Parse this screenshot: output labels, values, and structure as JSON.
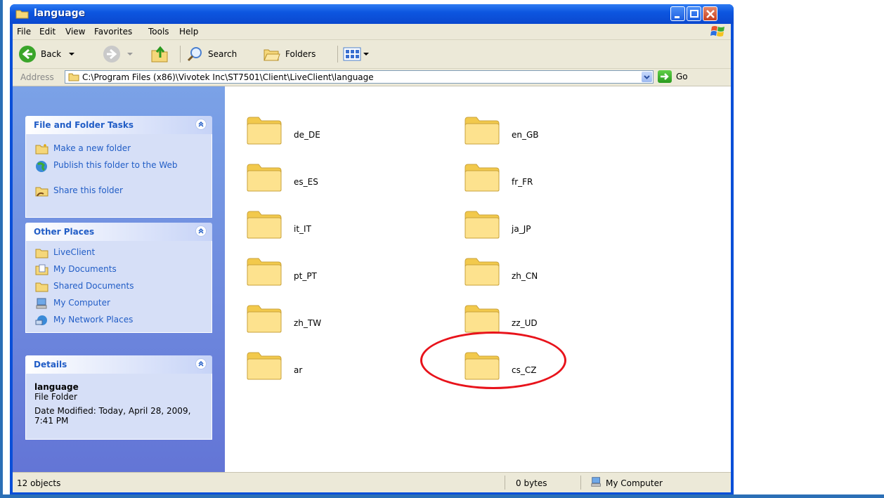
{
  "window": {
    "title": "language"
  },
  "menu": [
    "File",
    "Edit",
    "View",
    "Favorites",
    "Tools",
    "Help"
  ],
  "toolbar": {
    "back_label": "Back",
    "search_label": "Search",
    "folders_label": "Folders"
  },
  "address": {
    "label": "Address",
    "path": "C:\\Program Files (x86)\\Vivotek Inc\\ST7501\\Client\\LiveClient\\language",
    "go_label": "Go"
  },
  "sidebar": {
    "tasks": {
      "title": "File and Folder Tasks",
      "items": [
        {
          "label": "Make a new folder",
          "icon": "new-folder-icon"
        },
        {
          "label": "Publish this folder to the Web",
          "icon": "publish-web-icon"
        },
        {
          "label": "Share this folder",
          "icon": "share-folder-icon"
        }
      ]
    },
    "places": {
      "title": "Other Places",
      "items": [
        {
          "label": "LiveClient",
          "icon": "folder-icon"
        },
        {
          "label": "My Documents",
          "icon": "documents-icon"
        },
        {
          "label": "Shared Documents",
          "icon": "folder-icon"
        },
        {
          "label": "My Computer",
          "icon": "computer-icon"
        },
        {
          "label": "My Network Places",
          "icon": "network-icon"
        }
      ]
    },
    "details": {
      "title": "Details",
      "name": "language",
      "type": "File Folder",
      "modified": "Date Modified: Today, April 28, 2009, 7:41 PM"
    }
  },
  "folders": [
    "de_DE",
    "en_GB",
    "es_ES",
    "fr_FR",
    "it_IT",
    "ja_JP",
    "pt_PT",
    "zh_CN",
    "zh_TW",
    "zz_UD",
    "ar",
    "cs_CZ"
  ],
  "highlighted_folder": "cs_CZ",
  "status": {
    "objects": "12 objects",
    "size": "0 bytes",
    "location": "My Computer"
  },
  "colors": {
    "titlebar": "#0a4fd8",
    "sidebar": "#6f8fe0",
    "task_link": "#215dc6",
    "highlight_ellipse": "#e8131b"
  }
}
